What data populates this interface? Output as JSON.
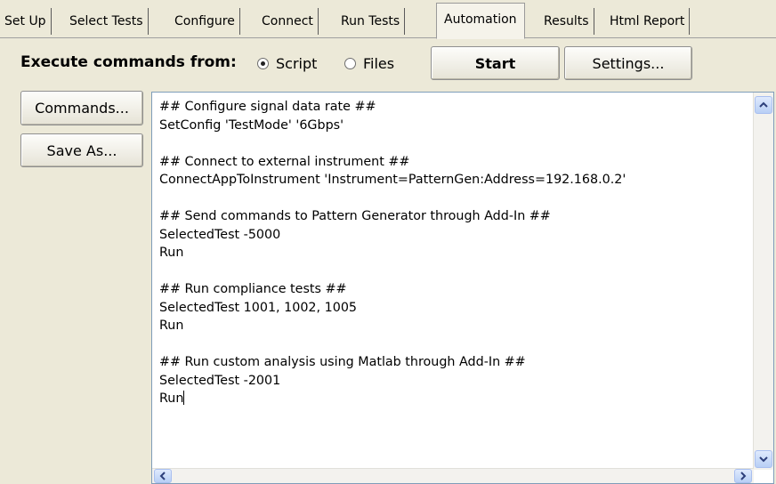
{
  "tabs": [
    {
      "label": "Set Up"
    },
    {
      "label": "Select Tests"
    },
    {
      "label": "Configure"
    },
    {
      "label": "Connect"
    },
    {
      "label": "Run Tests"
    },
    {
      "label": "Automation"
    },
    {
      "label": "Results"
    },
    {
      "label": "Html Report"
    }
  ],
  "active_tab": "Automation",
  "execute": {
    "label": "Execute commands from:",
    "options": [
      {
        "label": "Script",
        "selected": true
      },
      {
        "label": "Files",
        "selected": false
      }
    ],
    "start_label": "Start",
    "settings_label": "Settings..."
  },
  "side_buttons": {
    "commands_label": "Commands...",
    "save_as_label": "Save As..."
  },
  "script": {
    "lines": [
      "## Configure signal data rate ##",
      "SetConfig 'TestMode' '6Gbps'",
      "",
      "## Connect to external instrument ##",
      "ConnectAppToInstrument 'Instrument=PatternGen:Address=192.168.0.2'",
      "",
      "## Send commands to Pattern Generator through Add-In ##",
      "SelectedTest -5000",
      "Run",
      "",
      "## Run compliance tests ##",
      "SelectedTest 1001, 1002, 1005",
      "Run",
      "",
      "## Run custom analysis using Matlab through Add-In ##",
      "SelectedTest -2001",
      "Run"
    ]
  },
  "icons": {
    "scroll_up": "chevron-up-icon",
    "scroll_down": "chevron-down-icon",
    "scroll_left": "chevron-left-icon",
    "scroll_right": "chevron-right-icon"
  }
}
